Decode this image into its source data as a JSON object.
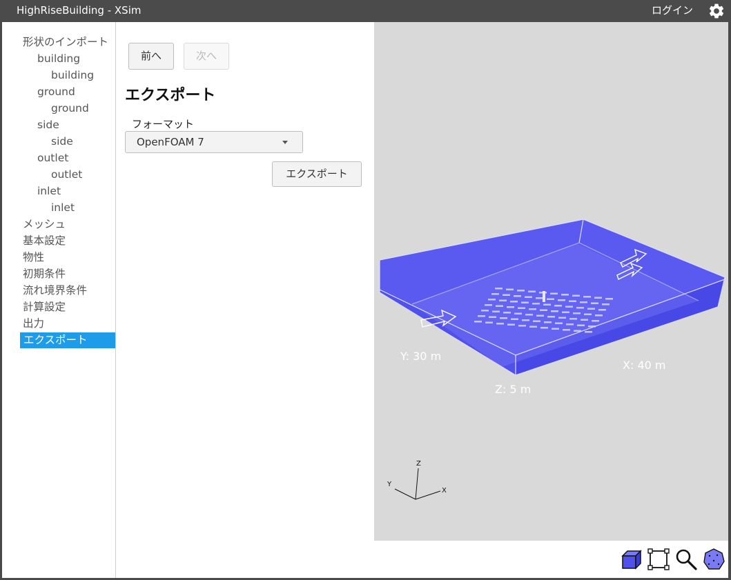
{
  "window": {
    "title": "HighRiseBuilding - XSim",
    "login_label": "ログイン"
  },
  "sidebar": {
    "items": [
      {
        "label": "形状のインポート",
        "level": 0
      },
      {
        "label": "building",
        "level": 1
      },
      {
        "label": "building",
        "level": 2
      },
      {
        "label": "ground",
        "level": 1
      },
      {
        "label": "ground",
        "level": 2
      },
      {
        "label": "side",
        "level": 1
      },
      {
        "label": "side",
        "level": 2
      },
      {
        "label": "outlet",
        "level": 1
      },
      {
        "label": "outlet",
        "level": 2
      },
      {
        "label": "inlet",
        "level": 1
      },
      {
        "label": "inlet",
        "level": 2
      },
      {
        "label": "メッシュ",
        "level": 0
      },
      {
        "label": "基本設定",
        "level": 0
      },
      {
        "label": "物性",
        "level": 0
      },
      {
        "label": "初期条件",
        "level": 0
      },
      {
        "label": "流れ境界条件",
        "level": 0
      },
      {
        "label": "計算設定",
        "level": 0
      },
      {
        "label": "出力",
        "level": 0
      },
      {
        "label": "エクスポート",
        "level": 0,
        "active": true
      }
    ]
  },
  "panel": {
    "prev_label": "前へ",
    "next_label": "次へ",
    "heading": "エクスポート",
    "format_label": "フォーマット",
    "format_value": "OpenFOAM 7",
    "export_label": "エクスポート"
  },
  "viewport": {
    "dim_y": "Y: 30 m",
    "dim_x": "X: 40 m",
    "dim_z": "Z: 5 m",
    "axis_z": "Z",
    "axis_y": "Y",
    "axis_x": "X",
    "domain_color": "#5a5af0",
    "background_color": "#d9d9d9"
  },
  "toolbar": {
    "tools": [
      {
        "name": "solid-view-icon"
      },
      {
        "name": "fit-view-icon"
      },
      {
        "name": "zoom-icon"
      },
      {
        "name": "mesh-view-icon"
      }
    ]
  }
}
